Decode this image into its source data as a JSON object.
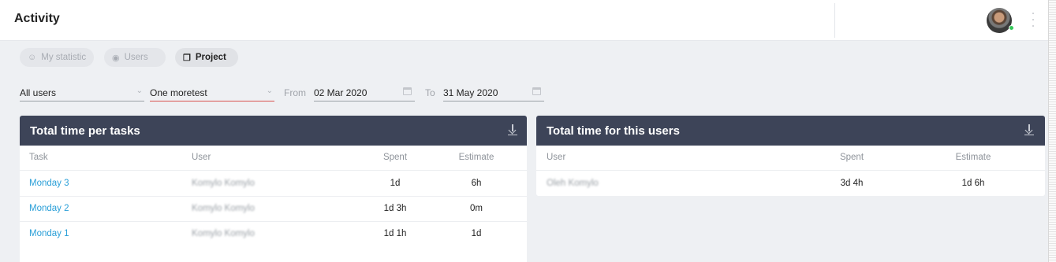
{
  "header": {
    "title": "Activity"
  },
  "tabs": [
    {
      "label": "My statistic",
      "icon": "user-icon",
      "active": false
    },
    {
      "label": "Users",
      "icon": "users-icon",
      "active": false
    },
    {
      "label": "Project",
      "icon": "cube-icon",
      "active": true
    }
  ],
  "filters": {
    "user_select": "All users",
    "project_select": "One moretest",
    "from_label": "From",
    "from_date": "02 Mar 2020",
    "to_label": "To",
    "to_date": "31 May 2020"
  },
  "tasks_card": {
    "title": "Total time per tasks",
    "columns": [
      "Task",
      "User",
      "Spent",
      "Estimate"
    ],
    "rows": [
      {
        "task": "Monday 3",
        "user": "Komylo Komylo",
        "spent": "1d",
        "estimate": "6h"
      },
      {
        "task": "Monday 2",
        "user": "Komylo Komylo",
        "spent": "1d 3h",
        "estimate": "0m"
      },
      {
        "task": "Monday 1",
        "user": "Komylo Komylo",
        "spent": "1d 1h",
        "estimate": "1d"
      }
    ]
  },
  "users_card": {
    "title": "Total time for this users",
    "columns": [
      "User",
      "Spent",
      "Estimate"
    ],
    "rows": [
      {
        "user": "Oleh Komylo",
        "spent": "3d 4h",
        "estimate": "1d 6h"
      }
    ]
  },
  "colors": {
    "card_header": "#3d4458",
    "link": "#2a9fd8",
    "accent_underline": "#d9534f",
    "online": "#34c759"
  }
}
